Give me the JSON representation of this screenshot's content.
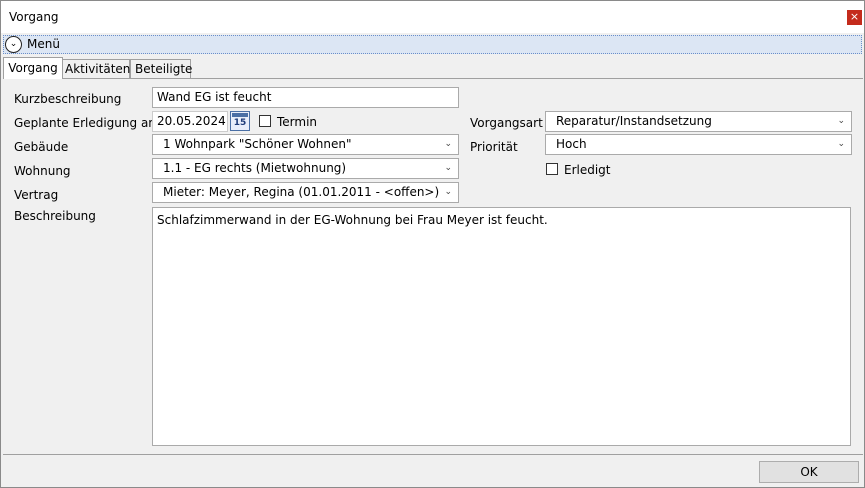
{
  "window": {
    "title": "Vorgang",
    "close_glyph": "×"
  },
  "menu": {
    "label": "Menü",
    "icon": "chevron-down-circle-icon"
  },
  "tabs": [
    {
      "label": "Vorgang",
      "active": true
    },
    {
      "label": "Aktivitäten",
      "active": false
    },
    {
      "label": "Beteiligte",
      "active": false
    }
  ],
  "form": {
    "kurzbeschreibung": {
      "label": "Kurzbeschreibung",
      "value": "Wand EG ist feucht"
    },
    "erledigung": {
      "label": "Geplante Erledigung am",
      "value": "20.05.2024",
      "calendar_day": "15",
      "termin_label": "Termin",
      "termin_checked": false
    },
    "gebaeude": {
      "label": "Gebäude",
      "value": "1 Wohnpark \"Schöner Wohnen\""
    },
    "wohnung": {
      "label": "Wohnung",
      "value": "1.1 - EG rechts (Mietwohnung)"
    },
    "vertrag": {
      "label": "Vertrag",
      "value": "Mieter: Meyer, Regina (01.01.2011 - <offen>)"
    },
    "beschreibung": {
      "label": "Beschreibung",
      "value": "Schlafzimmerwand in der EG-Wohnung bei Frau Meyer ist feucht."
    },
    "vorgangsart": {
      "label": "Vorgangsart",
      "value": "Reparatur/Instandsetzung"
    },
    "prioritaet": {
      "label": "Priorität",
      "value": "Hoch"
    },
    "erledigt": {
      "label": "Erledigt",
      "checked": false
    }
  },
  "buttons": {
    "ok": "OK"
  },
  "colors": {
    "accent": "#c42b1c",
    "menu_bg": "#dce6f4"
  }
}
